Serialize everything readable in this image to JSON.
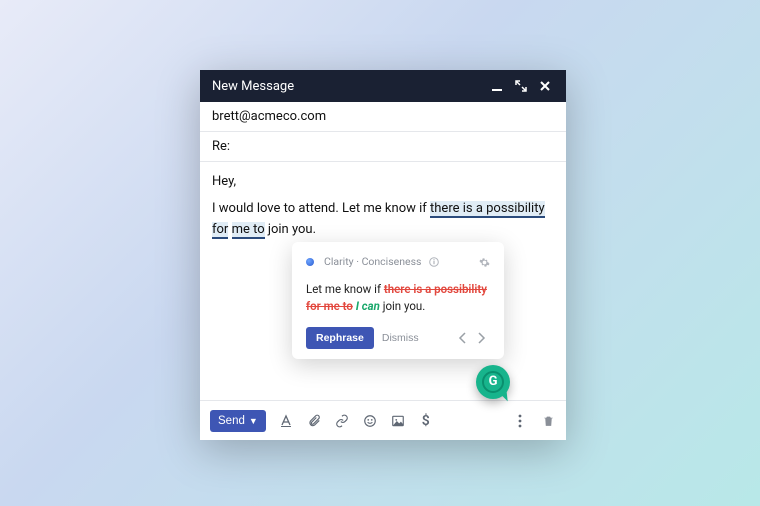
{
  "window": {
    "title": "New Message"
  },
  "fields": {
    "to": "brett@acmeco.com",
    "subject": "Re:"
  },
  "body": {
    "greeting": "Hey,",
    "pre": "I would love to attend. Let me know if ",
    "highlight1": "there is a possibility for",
    "highlight2": "me to",
    "post": " join you."
  },
  "popup": {
    "category": "Clarity · Conciseness",
    "pre": "Let me know if ",
    "strike1": "there is a possibility",
    "strike2": "for me to",
    "insertion": "I can",
    "post": " join you.",
    "rephrase_label": "Rephrase",
    "dismiss_label": "Dismiss"
  },
  "badge": {
    "letter": "G"
  },
  "footer": {
    "send_label": "Send"
  }
}
